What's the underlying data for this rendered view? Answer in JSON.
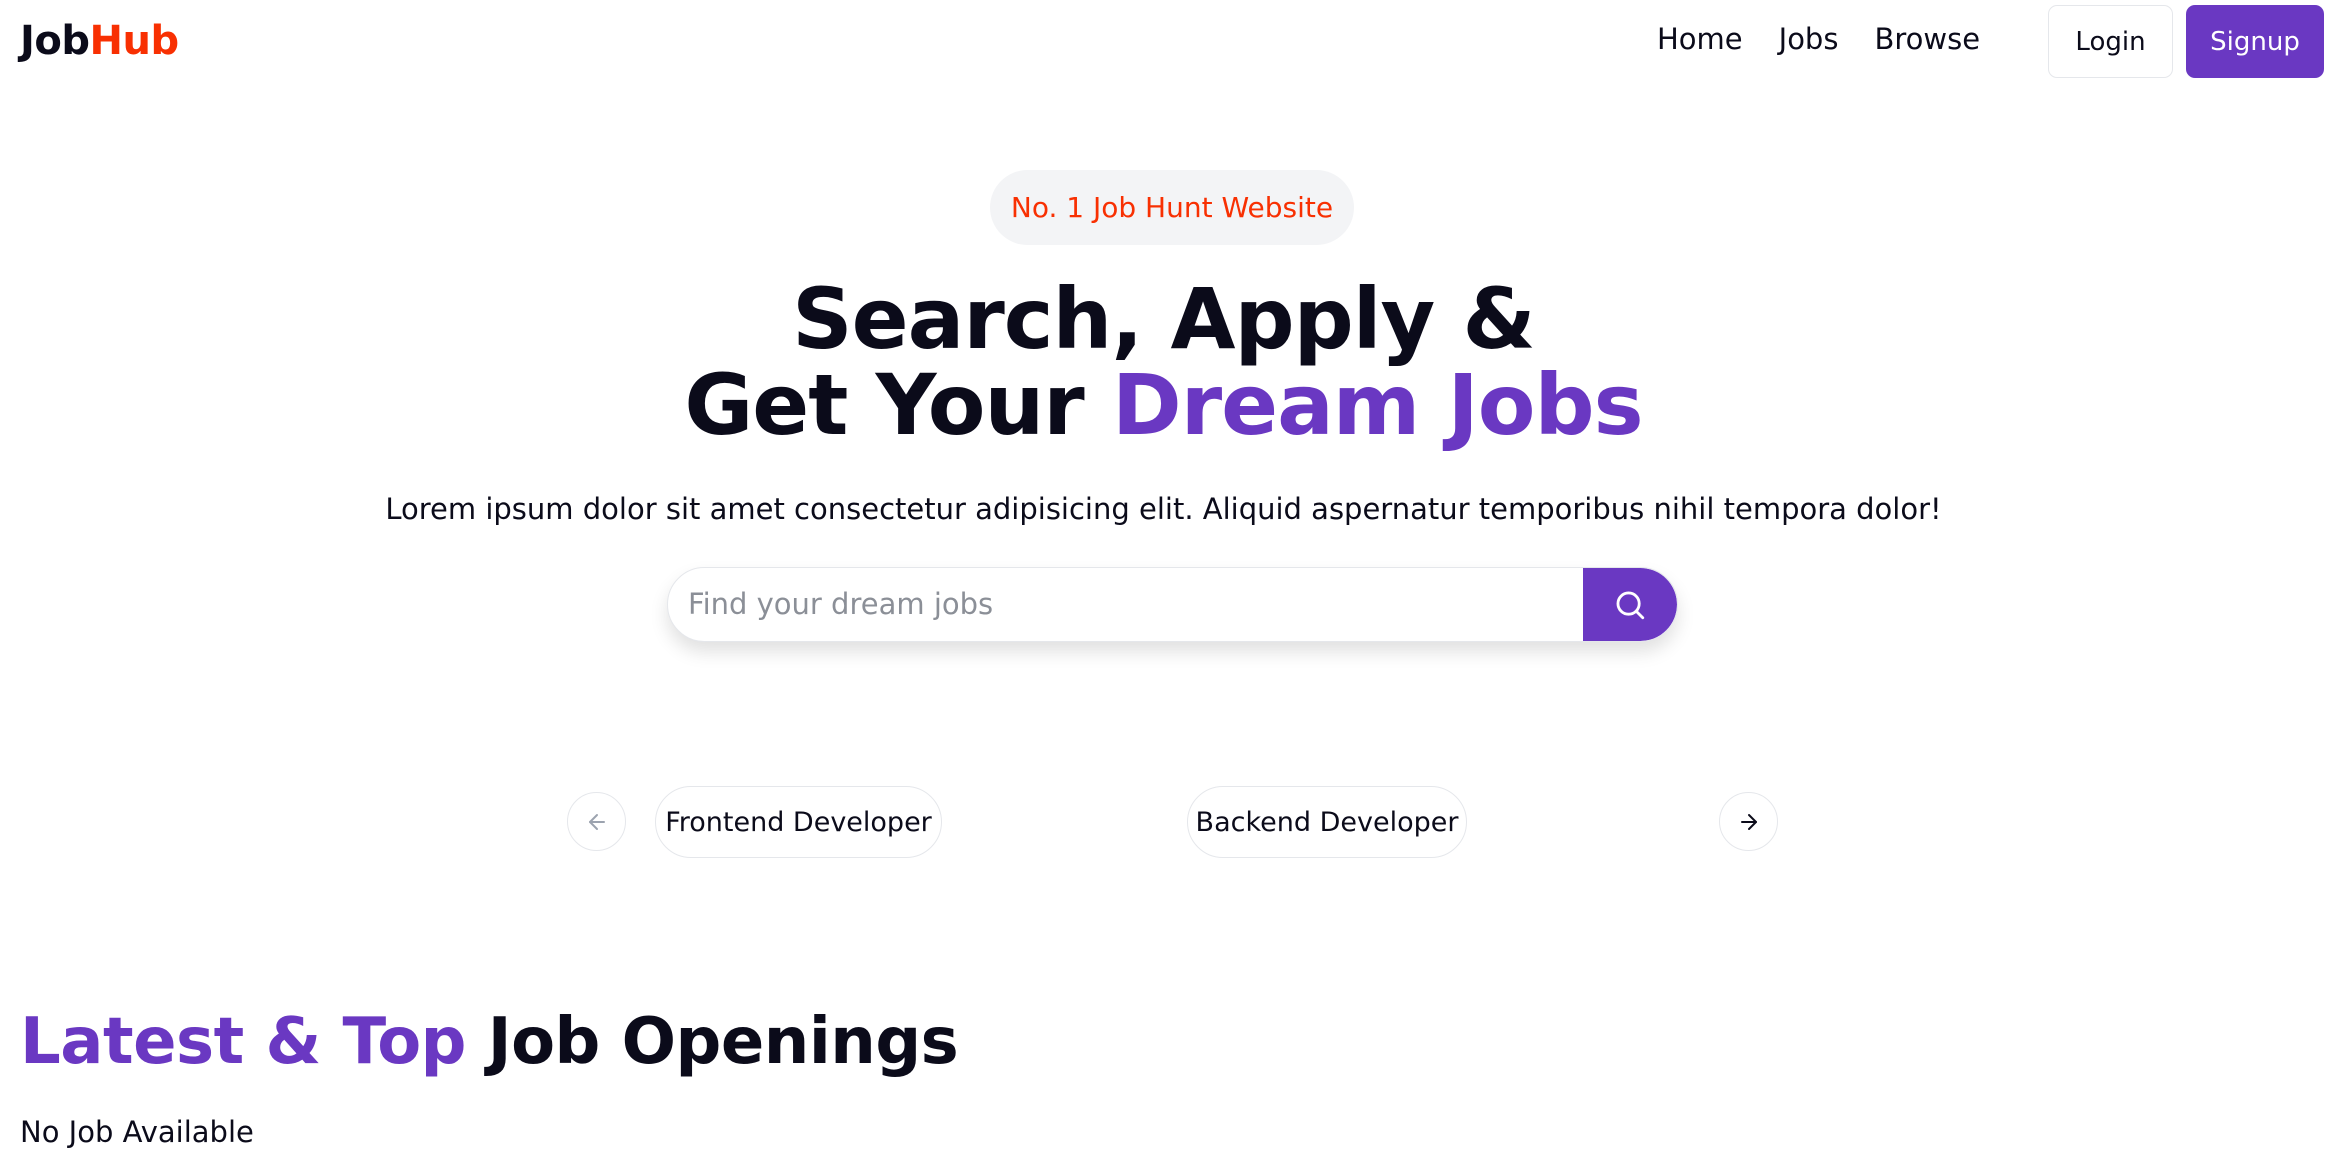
{
  "brand": {
    "part1": "Job",
    "part2": "Hub",
    "accent_color": "#f83002"
  },
  "nav": {
    "links": [
      "Home",
      "Jobs",
      "Browse"
    ],
    "login_label": "Login",
    "signup_label": "Signup"
  },
  "hero": {
    "badge": "No. 1 Job Hunt Website",
    "title_line1": "Search, Apply &",
    "title_line2_plain": "Get Your ",
    "title_line2_accent": "Dream Jobs",
    "subtitle": "Lorem ipsum dolor sit amet consectetur adipisicing elit. Aliquid aspernatur temporibus nihil tempora dolor!",
    "search_placeholder": "Find your dream jobs",
    "search_icon": "search-icon"
  },
  "carousel": {
    "prev_icon": "arrow-left-icon",
    "next_icon": "arrow-right-icon",
    "items": [
      "Frontend Developer",
      "Backend Developer"
    ]
  },
  "latest": {
    "title_accent": "Latest & Top",
    "title_plain": " Job Openings",
    "empty_text": "No Job Available"
  },
  "colors": {
    "primary": "#6a38c2",
    "accent": "#f83002"
  }
}
